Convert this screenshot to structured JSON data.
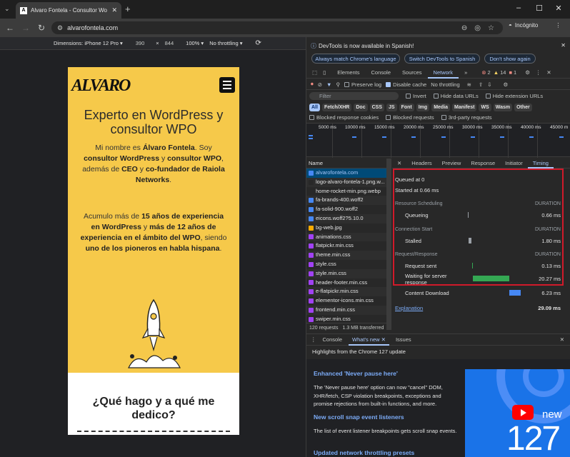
{
  "browser": {
    "tab_title": "Alvaro Fontela - Consultor Wo",
    "url": "alvarofontela.com",
    "incognito_label": "Incógnito",
    "new_tab": "+",
    "win_min": "–",
    "win_max": "☐",
    "win_close": "✕"
  },
  "device_toolbar": {
    "dimensions_label": "Dimensions: iPhone 12 Pro ▾",
    "width": "390",
    "times": "×",
    "height": "844",
    "zoom": "100% ▾",
    "throttle": "No throttling ▾"
  },
  "site": {
    "logo": "ALVARO",
    "heading": "Experto en WordPress y consultor WPO",
    "para1_parts": [
      "Mi nombre es ",
      "Álvaro Fontela",
      ". Soy ",
      "consultor WordPress",
      " y ",
      "consultor WPO",
      ", además de ",
      "CEO",
      " y ",
      "co-fundador de Raiola Networks",
      "."
    ],
    "para2_parts": [
      "Acumulo más de ",
      "15 años de experiencia en WordPress",
      " y ",
      "más de 12 años de experiencia en el ámbito del WPO",
      ", siendo ",
      "uno de los pioneros en habla hispana",
      "."
    ],
    "heading2": "¿Qué hago y a qué me dedico?"
  },
  "devtools": {
    "notice": "DevTools is now available in Spanish!",
    "btn_match": "Always match Chrome's language",
    "btn_switch": "Switch DevTools to Spanish",
    "btn_dont": "Don't show again",
    "tabs": [
      "Elements",
      "Console",
      "Sources",
      "Network"
    ],
    "errors": "2",
    "warnings": "14",
    "issues": "1",
    "preserve_log": "Preserve log",
    "disable_cache": "Disable cache",
    "throttling": "No throttling",
    "filter_placeholder": "Filter",
    "invert": "Invert",
    "hide_data_urls": "Hide data URLs",
    "hide_ext_urls": "Hide extension URLs",
    "types": [
      "All",
      "Fetch/XHR",
      "Doc",
      "CSS",
      "JS",
      "Font",
      "Img",
      "Media",
      "Manifest",
      "WS",
      "Wasm",
      "Other"
    ],
    "blocked_cookies": "Blocked response cookies",
    "blocked_requests": "Blocked requests",
    "third_party": "3rd-party requests",
    "timeline_labels": [
      "5000 ms",
      "10000 ms",
      "15000 ms",
      "20000 ms",
      "25000 ms",
      "30000 ms",
      "35000 ms",
      "40000 ms",
      "45000 m"
    ],
    "name_header": "Name",
    "requests": [
      {
        "name": "alvarofontela.com",
        "color": "#4688f4"
      },
      {
        "name": "logo-alvaro-fontela-1.png.w...",
        "color": "#282828"
      },
      {
        "name": "home-rocket-min.png.webp",
        "color": "#282828"
      },
      {
        "name": "fa-brands-400.woff2",
        "color": "#4688f4"
      },
      {
        "name": "fa-solid-900.woff2",
        "color": "#4688f4"
      },
      {
        "name": "eicons.woff2?5.10.0",
        "color": "#4688f4"
      },
      {
        "name": "bg-web.jpg",
        "color": "#f9ab00"
      },
      {
        "name": "animations.css",
        "color": "#a142f4"
      },
      {
        "name": "flatpickr.min.css",
        "color": "#a142f4"
      },
      {
        "name": "theme.min.css",
        "color": "#a142f4"
      },
      {
        "name": "style.css",
        "color": "#a142f4"
      },
      {
        "name": "style.min.css",
        "color": "#a142f4"
      },
      {
        "name": "header-footer.min.css",
        "color": "#a142f4"
      },
      {
        "name": "e-flatpickr.min.css",
        "color": "#a142f4"
      },
      {
        "name": "elementor-icons.min.css",
        "color": "#a142f4"
      },
      {
        "name": "frontend.min.css",
        "color": "#a142f4"
      },
      {
        "name": "swiper.min.css",
        "color": "#a142f4"
      }
    ],
    "status_requests": "120 requests",
    "status_transferred": "1.3 MB transferred",
    "detail_tabs": [
      "Headers",
      "Preview",
      "Response",
      "Initiator",
      "Timing"
    ],
    "timing": {
      "queued": "Queued at 0",
      "started": "Started at 0.66 ms",
      "resource_scheduling": "Resource Scheduling",
      "duration": "DURATION",
      "queueing": "Queueing",
      "queueing_val": "0.66 ms",
      "connection_start": "Connection Start",
      "stalled": "Stalled",
      "stalled_val": "1.80 ms",
      "request_response": "Request/Response",
      "request_sent": "Request sent",
      "request_sent_val": "0.13 ms",
      "waiting": "Waiting for server response",
      "waiting_val": "20.27 ms",
      "content_download": "Content Download",
      "content_download_val": "6.23 ms",
      "explanation": "Explanation",
      "total": "29.09 ms"
    },
    "drawer_tabs": [
      "Console",
      "What's new",
      "Issues"
    ],
    "whats_new_title": "Highlights from the Chrome 127 update",
    "wn_h1": "Enhanced 'Never pause here'",
    "wn_p1": "The 'Never pause here' option can now \"cancel\" DOM, XHR/fetch, CSP violation breakpoints, exceptions and promise rejections from built-in functions, and more.",
    "wn_h2": "New scroll snap event listeners",
    "wn_p2": "The list of event listener breakpoints gets scroll snap events.",
    "wn_h3": "Updated network throttling presets",
    "promo_new": "new",
    "promo_num": "127"
  }
}
